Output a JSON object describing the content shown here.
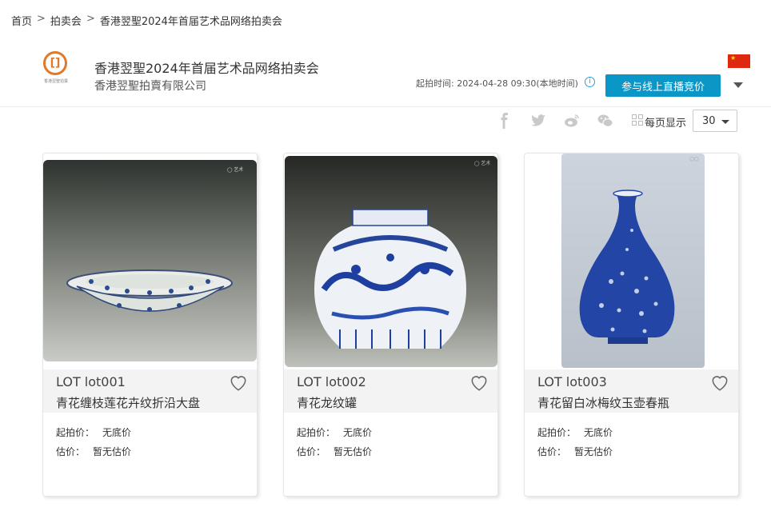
{
  "breadcrumb": {
    "home": "首页",
    "sep1": ">",
    "auctions": "拍卖会",
    "sep2": ">",
    "current": "香港翌聖2024年首届艺术品网络拍卖会"
  },
  "header": {
    "logo_mark": "[]",
    "logo_text": "香港翌聖拍賣",
    "title": "香港翌聖2024年首届艺术品网络拍卖会",
    "company": "香港翌聖拍賣有限公司",
    "start_label": "起拍时间:",
    "start_time": "2024-04-28 09:30(本地时间)",
    "info_icon": "i",
    "bid_button": "参与线上直播竞价",
    "flag_star": "★"
  },
  "toolbar": {
    "per_page_label": "每页显示",
    "per_page_value": "30",
    "share_icons": [
      "facebook-icon",
      "twitter-icon",
      "weibo-icon",
      "wechat-icon"
    ]
  },
  "lots": [
    {
      "lot": "LOT lot001",
      "name": "青花缠枝莲花卉纹折沿大盘",
      "start_k": "起拍价：",
      "start_v": "无底价",
      "est_k": "估价：",
      "est_v": "暂无估价"
    },
    {
      "lot": "LOT lot002",
      "name": "青花龙纹罐",
      "start_k": "起拍价：",
      "start_v": "无底价",
      "est_k": "估价：",
      "est_v": "暂无估价"
    },
    {
      "lot": "LOT lot003",
      "name": "青花留白冰梅纹玉壶春瓶",
      "start_k": "起拍价：",
      "start_v": "无底价",
      "est_k": "估价：",
      "est_v": "暂无估价"
    }
  ],
  "colors": {
    "accent": "#0a96c6",
    "logo": "#e07a2a",
    "blue_porcelain": "#1f3fa0"
  }
}
